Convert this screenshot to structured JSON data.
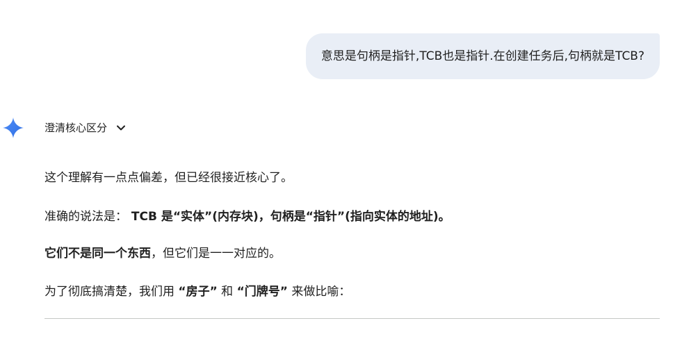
{
  "user_message": "意思是句柄是指针,TCB也是指针.在创建任务后,句柄就是TCB?",
  "response": {
    "thinking_label": "澄清核心区分",
    "paragraphs": [
      {
        "segments": [
          {
            "text": "这个理解有一点点偏差，但已经很接近核心了。",
            "bold": false
          }
        ]
      },
      {
        "segments": [
          {
            "text": "准确的说法是：",
            "bold": false
          },
          {
            "text": " TCB 是“实体”(内存块)，句柄是“指针”(指向实体的地址)。",
            "bold": true
          }
        ]
      },
      {
        "segments": [
          {
            "text": "它们不是同一个东西",
            "bold": true
          },
          {
            "text": "，但它们是一一对应的。",
            "bold": false
          }
        ]
      },
      {
        "segments": [
          {
            "text": "为了彻底搞清楚，我们用 ",
            "bold": false
          },
          {
            "text": "“房子”",
            "bold": true
          },
          {
            "text": " 和 ",
            "bold": false
          },
          {
            "text": "“门牌号”",
            "bold": true
          },
          {
            "text": " 来做比喻：",
            "bold": false
          }
        ]
      }
    ]
  },
  "colors": {
    "bubble_bg": "#e9eef6",
    "text": "#1f1f1f",
    "spark_blue": "#4285f4",
    "divider": "#c4c7c5"
  },
  "icons": {
    "spark": "gemini-spark-icon",
    "chevron": "chevron-down-icon"
  }
}
